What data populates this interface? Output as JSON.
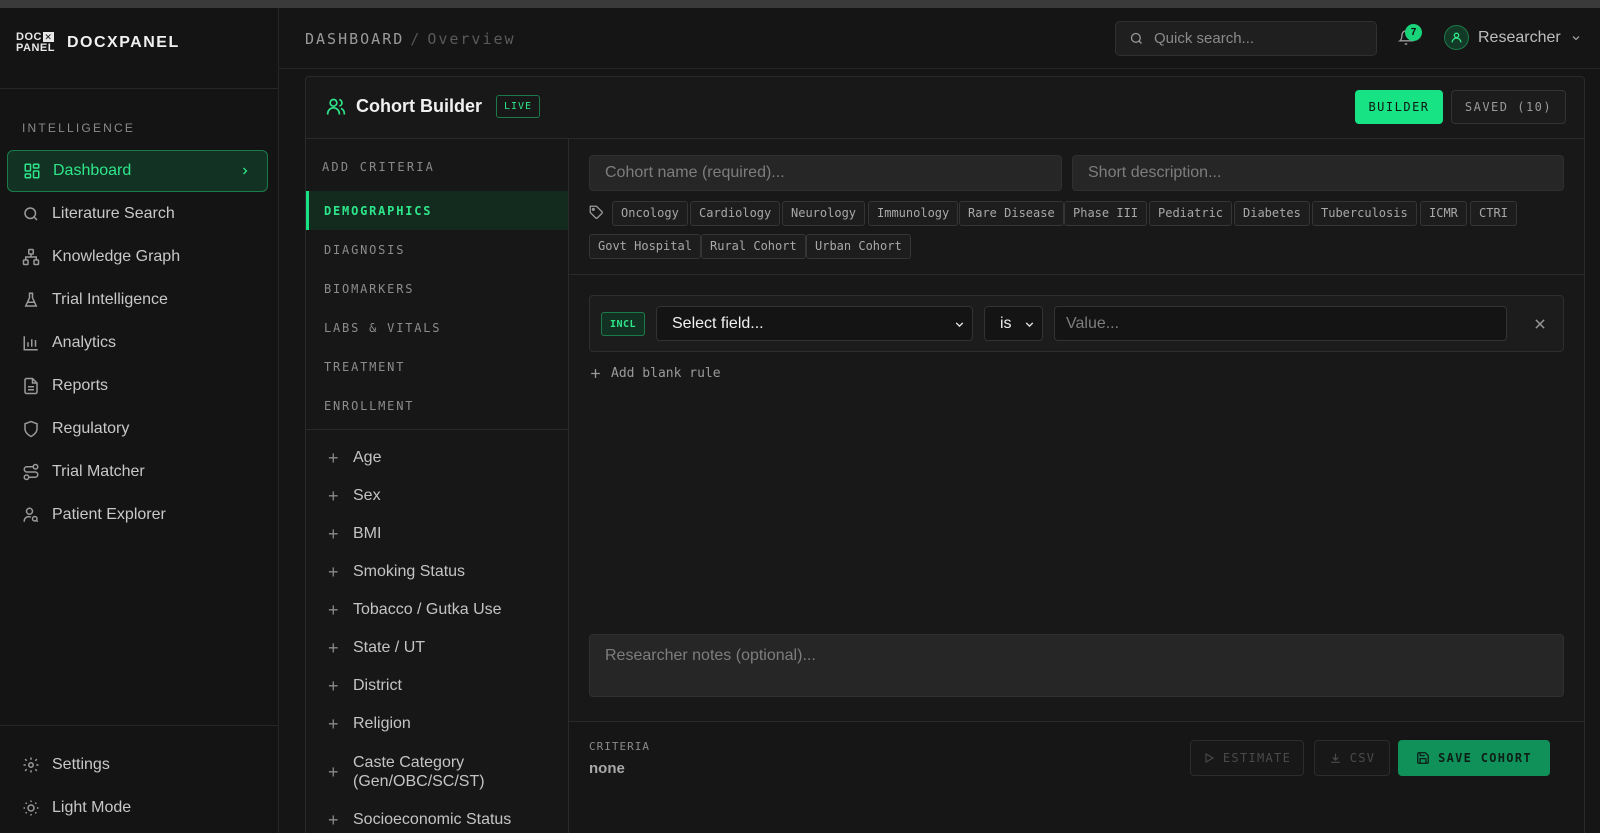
{
  "brand": {
    "logo_top": "DOC",
    "logo_x": "✕",
    "logo_bottom": "PANEL",
    "name": "DOCXPANEL"
  },
  "sidebar": {
    "section": "INTELLIGENCE",
    "items": [
      {
        "label": "Dashboard",
        "icon": "dashboard-icon",
        "active": true
      },
      {
        "label": "Literature Search",
        "icon": "search-icon"
      },
      {
        "label": "Knowledge Graph",
        "icon": "graph-icon"
      },
      {
        "label": "Trial Intelligence",
        "icon": "flask-icon"
      },
      {
        "label": "Analytics",
        "icon": "bar-chart-icon"
      },
      {
        "label": "Reports",
        "icon": "document-icon"
      },
      {
        "label": "Regulatory",
        "icon": "shield-icon"
      },
      {
        "label": "Trial Matcher",
        "icon": "route-icon"
      },
      {
        "label": "Patient Explorer",
        "icon": "user-search-icon"
      }
    ],
    "bottom": [
      {
        "label": "Settings",
        "icon": "gear-icon"
      },
      {
        "label": "Light Mode",
        "icon": "sun-icon"
      }
    ]
  },
  "header": {
    "breadcrumb": [
      "DASHBOARD",
      "Overview"
    ],
    "search_placeholder": "Quick search...",
    "notifications": "7",
    "user": "Researcher"
  },
  "panel": {
    "title": "Cohort Builder",
    "badge": "LIVE",
    "tabs": {
      "builder": "BUILDER",
      "saved": "SAVED (10)"
    }
  },
  "criteria": {
    "heading": "ADD CRITERIA",
    "categories": [
      "DEMOGRAPHICS",
      "DIAGNOSIS",
      "BIOMARKERS",
      "LABS & VITALS",
      "TREATMENT",
      "ENROLLMENT"
    ],
    "fields": [
      "Age",
      "Sex",
      "BMI",
      "Smoking Status",
      "Tobacco / Gutka Use",
      "State / UT",
      "District",
      "Religion",
      "Caste Category (Gen/OBC/SC/ST)",
      "Socioeconomic Status"
    ]
  },
  "form": {
    "name_placeholder": "Cohort name (required)...",
    "desc_placeholder": "Short description...",
    "tags": [
      "Oncology",
      "Cardiology",
      "Neurology",
      "Immunology",
      "Rare Disease",
      "Phase III",
      "Pediatric",
      "Diabetes",
      "Tuberculosis",
      "ICMR",
      "CTRI",
      "Govt Hospital",
      "Rural Cohort",
      "Urban Cohort"
    ],
    "rule": {
      "type": "INCL",
      "field": "Select field...",
      "operator": "is",
      "value_placeholder": "Value..."
    },
    "add_rule": "Add blank rule",
    "notes_placeholder": "Researcher notes (optional)..."
  },
  "footer": {
    "criteria_label": "CRITERIA",
    "criteria_value": "none",
    "estimate": "ESTIMATE",
    "csv": "CSV",
    "save": "SAVE COHORT"
  },
  "colors": {
    "accent": "#18e384",
    "accent_dark": "#10915a",
    "bg": "#151515"
  }
}
